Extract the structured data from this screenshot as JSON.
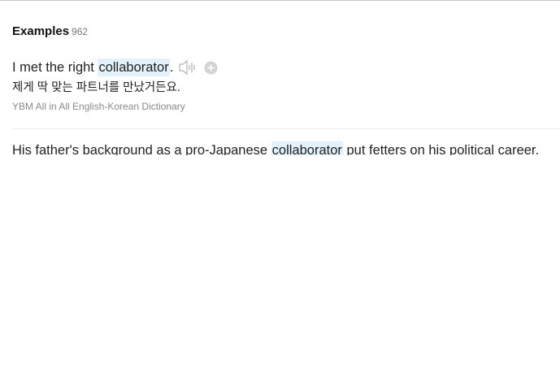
{
  "examples": {
    "title": "Examples",
    "count": "962",
    "items": [
      {
        "before": "I met the right ",
        "highlight": "collaborator",
        "after": ".",
        "translation": "제게 딱 맞는 파트너를 만났거든요.",
        "source": "YBM All in All English-Korean Dictionary",
        "icons": [
          "speaker-icon",
          "add-icon"
        ]
      },
      {
        "before": "His father's background as a pro-Japanese ",
        "highlight": "collaborator",
        "after": " put fetters on his political career."
      }
    ]
  },
  "colors": {
    "highlight": "#e3f1fb",
    "icon_gray": "#c8c8c8",
    "source_text": "#8a8a8a"
  }
}
